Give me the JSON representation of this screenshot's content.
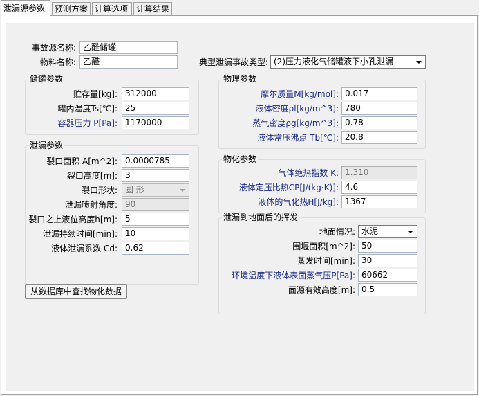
{
  "tabs": [
    "泄漏源参数",
    "预测方案",
    "计算选项",
    "计算结果"
  ],
  "source": {
    "name_label": "事故源名称:",
    "name_value": "乙醛储罐",
    "material_label": "物料名称:",
    "material_value": "乙醛",
    "type_label": "典型泄漏事故类型:",
    "type_value": "(2)压力液化气储罐液下小孔泄漏"
  },
  "tank": {
    "title": "储罐参数",
    "fields": [
      {
        "label": "贮存量[kg]:",
        "value": "312000"
      },
      {
        "label": "罐内温度Ts[℃]:",
        "value": "25"
      },
      {
        "label": "容器压力 P[Pa]:",
        "value": "1170000"
      }
    ]
  },
  "leak": {
    "title": "泄漏参数",
    "fields": [
      {
        "label": "裂口面积 A[m^2]:",
        "value": "0.0000785"
      },
      {
        "label": "裂口高度[m]:",
        "value": "3"
      },
      {
        "label": "裂口形状:",
        "value": "圆  形"
      },
      {
        "label": "泄漏喷射角度:",
        "value": "90"
      },
      {
        "label": "裂口之上液位高度h[m]:",
        "value": "5"
      },
      {
        "label": "泄漏持续时间[min]:",
        "value": "10"
      },
      {
        "label": "液体泄漏系数  Cd:",
        "value": "0.62"
      }
    ]
  },
  "physical": {
    "title": "物理参数",
    "fields": [
      {
        "label": "摩尔质量M[kg/mol]:",
        "value": "0.017"
      },
      {
        "label": "液体密度ρl[kg/m^3]:",
        "value": "780"
      },
      {
        "label": "蒸气密度ρg[kg/m^3]:",
        "value": "0.78"
      },
      {
        "label": "液体常压沸点 Tb[℃]:",
        "value": "20.8"
      }
    ]
  },
  "physchem": {
    "title": "物化参数",
    "fields": [
      {
        "label": "气体绝热指数  K:",
        "value": "1.310"
      },
      {
        "label": "液体定压比热CP[J/(kg·K)]:",
        "value": "4.6"
      },
      {
        "label": "液体的气化热H[J/kg]:",
        "value": "1367"
      }
    ]
  },
  "evap": {
    "title": "泄漏到地面后的挥发",
    "fields": [
      {
        "label": "地面情况:",
        "value": "水泥"
      },
      {
        "label": "围堰面积[m^2]:",
        "value": "50"
      },
      {
        "label": "蒸发时间[min]:",
        "value": "30"
      },
      {
        "label": "环境温度下液体表面蒸气压P[Pa]:",
        "value": "60662"
      },
      {
        "label": "面源有效高度[m]:",
        "value": "0.5"
      }
    ]
  },
  "db_button": "从数据库中查找物化数据"
}
